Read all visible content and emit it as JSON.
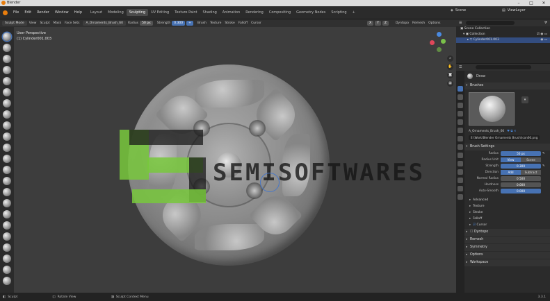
{
  "window": {
    "title": "Blender"
  },
  "menubar": {
    "menus": [
      "File",
      "Edit",
      "Render",
      "Window",
      "Help"
    ],
    "workspaces": [
      "Layout",
      "Modeling",
      "Sculpting",
      "UV Editing",
      "Texture Paint",
      "Shading",
      "Animation",
      "Rendering",
      "Compositing",
      "Geometry Nodes",
      "Scripting"
    ],
    "active_workspace": "Sculpting",
    "scene_label": "Scene",
    "view_layer_label": "ViewLayer"
  },
  "viewport_header": {
    "mode": "Sculpt Mode",
    "menus": [
      "View",
      "Sculpt",
      "Mask",
      "Face Sets"
    ],
    "brush_name": "A_Ornaments_Brush_60",
    "radius_label": "Radius",
    "radius_value": "50 px",
    "strength_label": "Strength",
    "strength_value": "0.300",
    "dropdowns": [
      "Brush",
      "Texture",
      "Stroke",
      "Falloff",
      "Cursor"
    ],
    "right_items": [
      "Dyntopo",
      "Remesh",
      "Options"
    ],
    "axis_toggles": [
      "X",
      "Y",
      "Z"
    ]
  },
  "viewport": {
    "perspective": "User Perspective",
    "object_label": "(1) Cylinder001.003",
    "watermark_text": "SEMISOFTWARES",
    "gizmo": {
      "x_color": "#e0475a",
      "y_color": "#7ac14a",
      "z_color": "#4a8ae0"
    }
  },
  "outliner": {
    "rows": [
      "Scene Collection",
      "Collection",
      "Cylinder001.003"
    ]
  },
  "properties": {
    "tool_name": "Draw",
    "brushes_panel": "Brushes",
    "brush_name": "A_Ornaments_Brush_60",
    "brush_file": "E:\\Work\\Blender Ornaments Brush\\icon60.png",
    "brush_settings_panel": "Brush Settings",
    "settings": [
      {
        "label": "Radius",
        "value": "50 px",
        "blue": true
      },
      {
        "label": "Radius Unit",
        "segments": [
          "View",
          "Scene"
        ],
        "on": 0
      },
      {
        "label": "Strength",
        "value": "0.300",
        "blue": true
      },
      {
        "label": "Direction",
        "segments": [
          "Add",
          "Subtract"
        ],
        "on": 0
      },
      {
        "label": "Normal Radius",
        "value": "0.500",
        "blue": false
      },
      {
        "label": "Hardness",
        "value": "0.000",
        "blue": false
      },
      {
        "label": "Auto-Smooth",
        "value": "0.000",
        "blue": true
      }
    ],
    "sub_panels": [
      "Advanced",
      "Texture",
      "Stroke",
      "Falloff",
      "Cursor"
    ],
    "panels": [
      "Dyntopo",
      "Remesh",
      "Symmetry",
      "Options",
      "Workspace"
    ]
  },
  "statusbar": {
    "items": [
      "Sculpt",
      "Rotate View",
      "Sculpt Context Menu"
    ],
    "version": "3.3.1"
  }
}
